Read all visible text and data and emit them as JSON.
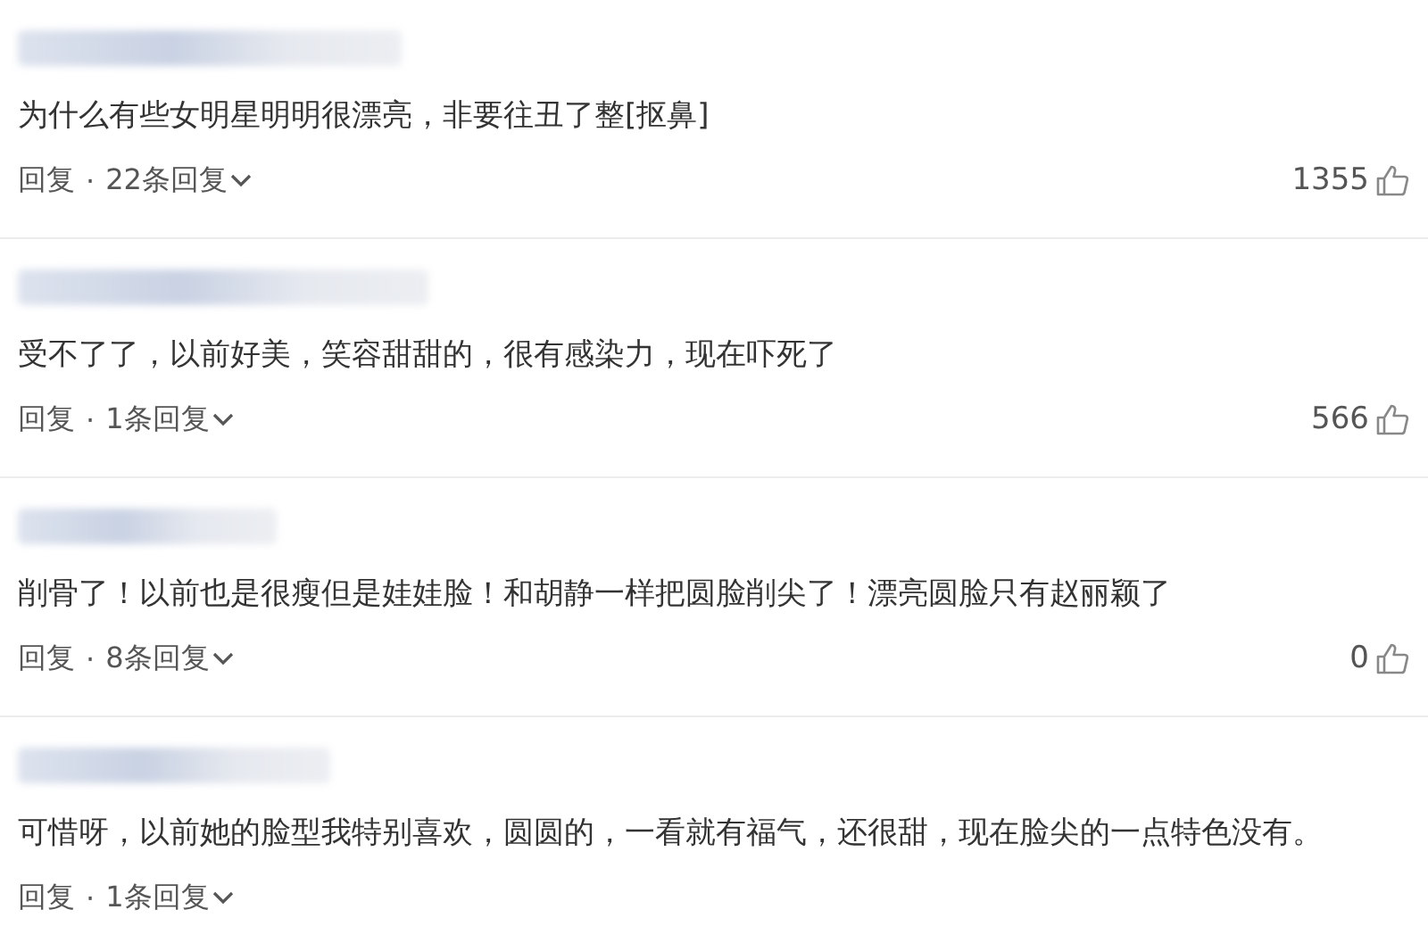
{
  "comments": [
    {
      "text": "为什么有些女明星明明很漂亮，非要往丑了整[抠鼻]",
      "reply_label": "回复",
      "separator": "·",
      "replies": "22条回复",
      "likes": "1355"
    },
    {
      "text": "受不了了，以前好美，笑容甜甜的，很有感染力，现在吓死了",
      "reply_label": "回复",
      "separator": "·",
      "replies": "1条回复",
      "likes": "566"
    },
    {
      "text": "削骨了！以前也是很瘦但是娃娃脸！和胡静一样把圆脸削尖了！漂亮圆脸只有赵丽颖了",
      "reply_label": "回复",
      "separator": "·",
      "replies": "8条回复",
      "likes": "0"
    },
    {
      "text": "可惜呀，以前她的脸型我特别喜欢，圆圆的，一看就有福气，还很甜，现在脸尖的一点特色没有。",
      "reply_label": "回复",
      "separator": "·",
      "replies": "1条回复"
    }
  ]
}
